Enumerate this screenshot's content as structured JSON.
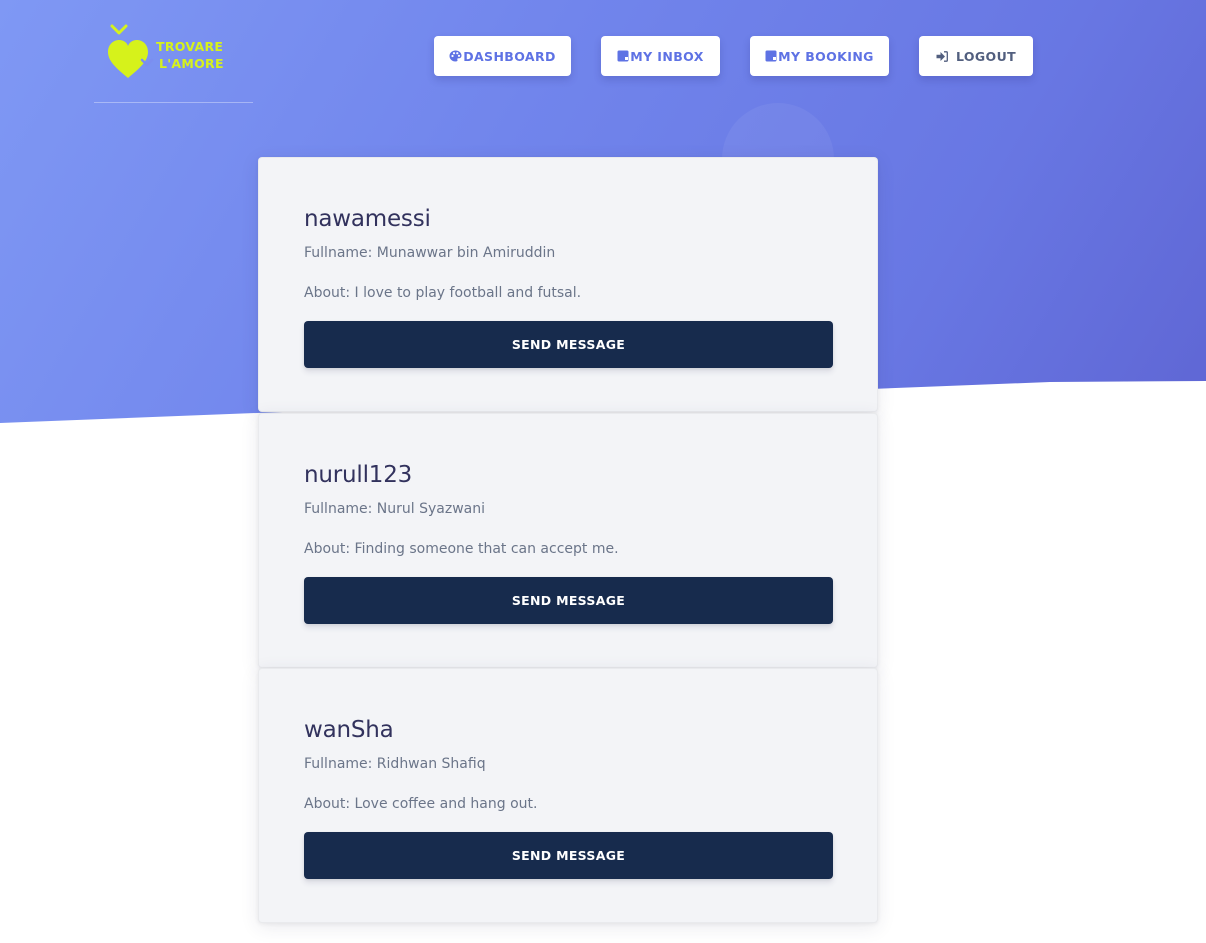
{
  "brand": {
    "line1": "TROVARE",
    "line2": "L'AMORE",
    "color": "#d6f21b"
  },
  "nav": {
    "dashboard": {
      "label": "DASHBOARD",
      "icon": "palette-icon"
    },
    "inbox": {
      "label": "MY INBOX",
      "icon": "inbox-icon"
    },
    "booking": {
      "label": "MY BOOKING",
      "icon": "booking-icon"
    },
    "logout": {
      "label": "LOGOUT",
      "icon": "sign-out-icon"
    }
  },
  "profiles": [
    {
      "username": "nawamessi",
      "fullname": "Fullname: Munawwar bin Amiruddin",
      "about": "About: I love to play football and futsal.",
      "button": "SEND MESSAGE"
    },
    {
      "username": "nurull123",
      "fullname": "Fullname: Nurul Syazwani",
      "about": "About: Finding someone that can accept me.",
      "button": "SEND MESSAGE"
    },
    {
      "username": "wanSha",
      "fullname": "Fullname: Ridhwan Shafiq",
      "about": "About: Love coffee and hang out.",
      "button": "SEND MESSAGE"
    }
  ],
  "colors": {
    "accent": "#5e72e4",
    "dark_button": "#172b4d",
    "card_bg": "#f3f4f7"
  }
}
